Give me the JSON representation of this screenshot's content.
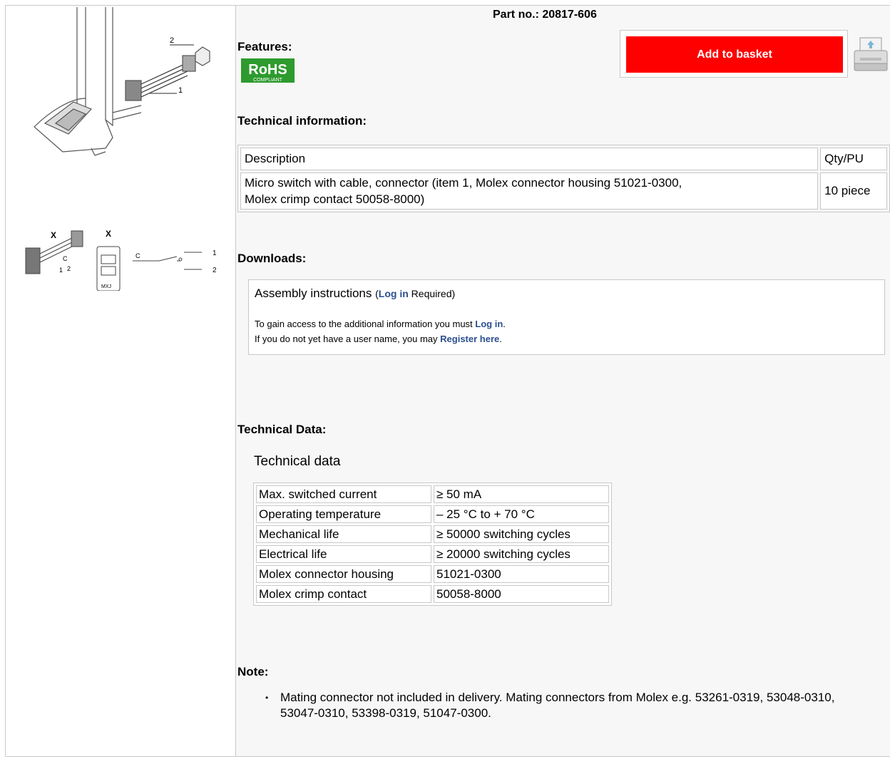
{
  "part": {
    "label": "Part no.: 20817-606"
  },
  "features": {
    "heading": "Features:",
    "rohs_top": "RoHS",
    "rohs_bottom": "COMPLIANT"
  },
  "basket": {
    "label": "Add to basket"
  },
  "technical_info": {
    "heading": "Technical information:",
    "columns": [
      "Description",
      "Qty/PU"
    ],
    "rows": [
      {
        "description_line1": "Micro switch with cable, connector (item 1, Molex connector housing 51021-0300,",
        "description_line2": "Molex crimp contact 50058-8000)",
        "qty": "10 piece"
      }
    ]
  },
  "downloads": {
    "heading": "Downloads:",
    "item_title": "Assembly instructions",
    "paren_open": "(",
    "login_label": "Log in",
    "required": " Required)",
    "access_text": "To gain access to the additional information you must ",
    "access_link": "Log in",
    "access_end": ".",
    "register_text": "If you do not yet have a user name, you may ",
    "register_link": "Register here",
    "register_end": "."
  },
  "technical_data": {
    "heading": "Technical Data:",
    "title": "Technical data",
    "rows": [
      {
        "label": "Max. switched current",
        "value": "≥ 50 mA"
      },
      {
        "label": "Operating temperature",
        "value": "– 25 °C to + 70 °C"
      },
      {
        "label": "Mechanical life",
        "value": "≥ 50000 switching cycles"
      },
      {
        "label": "Electrical life",
        "value": "≥ 20000 switching cycles"
      },
      {
        "label": "Molex connector housing",
        "value": "51021-0300"
      },
      {
        "label": "Molex crimp contact",
        "value": "50058-8000"
      }
    ]
  },
  "note": {
    "heading": "Note:",
    "items": [
      "Mating connector not included in delivery. Mating connectors from Molex e.g. 53261-0319, 53048-0310, 53047-0310, 53398-0319, 51047-0300."
    ]
  },
  "drawing": {
    "label_1": "1",
    "label_2": "2",
    "label_x": "X",
    "label_c": "C",
    "label_mx": "MXJ"
  },
  "colors": {
    "basket": "#ff0000",
    "link": "#2b4f8f",
    "rohs_green": "#2e9b2e"
  }
}
